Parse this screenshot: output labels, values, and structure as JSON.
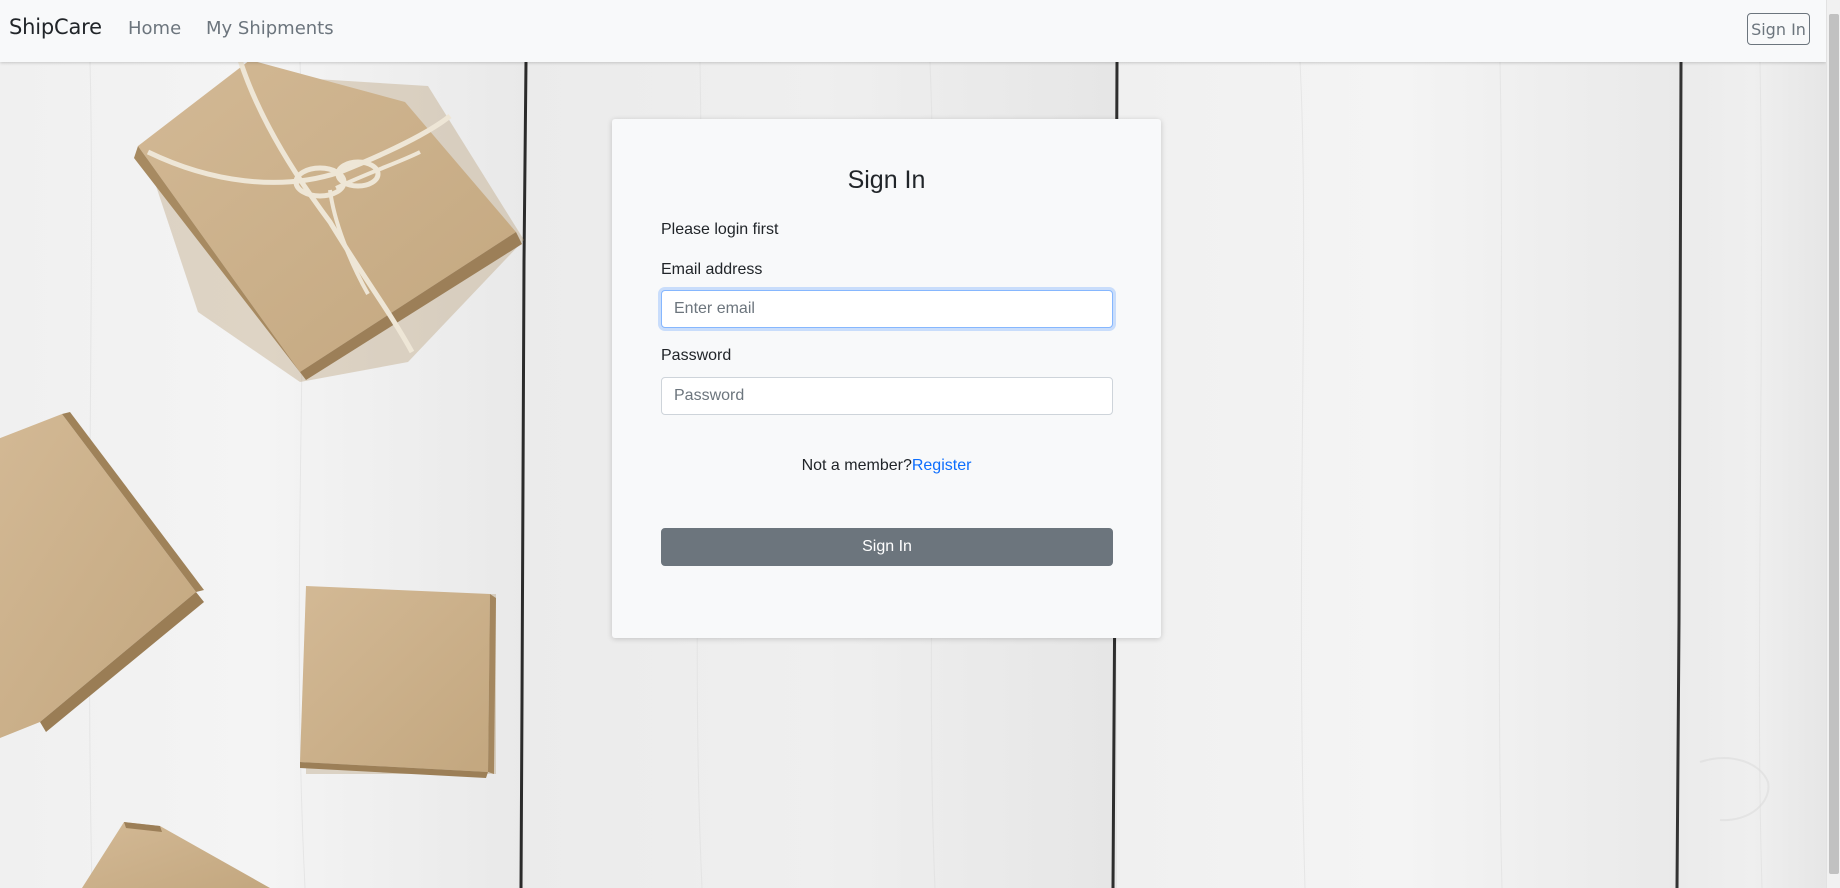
{
  "navbar": {
    "brand": "ShipCare",
    "links": [
      {
        "label": "Home"
      },
      {
        "label": "My Shipments"
      }
    ],
    "signin_button": "Sign In"
  },
  "login_card": {
    "title": "Sign In",
    "subtitle": "Please login first",
    "email": {
      "label": "Email address",
      "value": "",
      "placeholder": "Enter email",
      "focused": true
    },
    "password": {
      "label": "Password",
      "value": "",
      "placeholder": "Password"
    },
    "member_prompt": "Not a member?",
    "register_link": "Register",
    "submit_button": "Sign In"
  },
  "colors": {
    "navbar_bg": "#f8f9fa",
    "card_bg": "#f8f9fa",
    "primary_link": "#0d6efd",
    "secondary_button": "#6c757d",
    "text": "#212529"
  }
}
